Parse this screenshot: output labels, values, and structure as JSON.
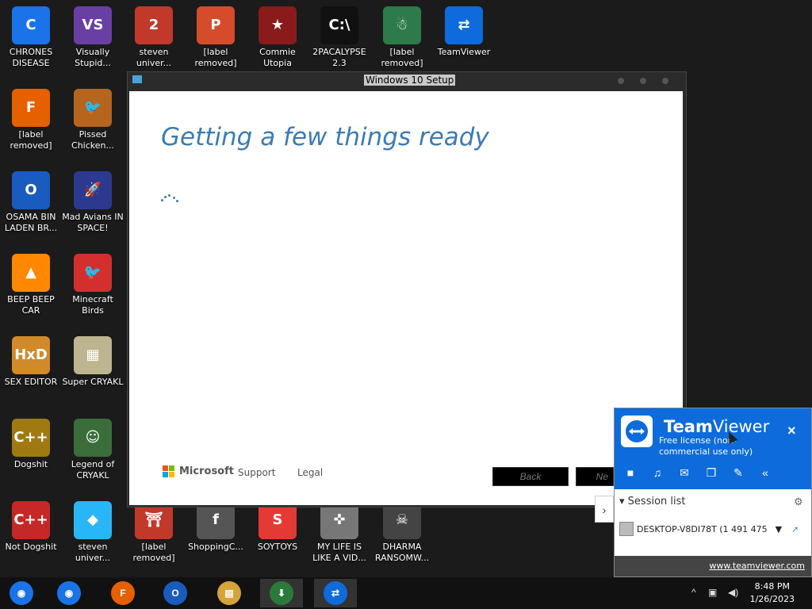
{
  "colors": {
    "desktop_bg": "#1b1b1b",
    "accent_blue": "#3b7bb5",
    "teamviewer_blue": "#0e6bdc"
  },
  "desktop": {
    "icons": [
      {
        "label": "CHRONES DISEASE",
        "icon": "chrome-icon",
        "color": "#1a73e8"
      },
      {
        "label": "Visually Stupid...",
        "icon": "visual-studio-icon",
        "color": "#6a3fa3"
      },
      {
        "label": "steven univer...",
        "icon": "game-2-icon",
        "color": "#c0392b"
      },
      {
        "label": "[label removed]",
        "icon": "p-game-icon",
        "color": "#d64b2b"
      },
      {
        "label": "Commie Utopia",
        "icon": "game-emblem-icon",
        "color": "#8b1a1a"
      },
      {
        "label": "2PACALYPSE 2.3",
        "icon": "command-prompt-icon",
        "color": "#111111"
      },
      {
        "label": "[label removed]",
        "icon": "elf-game-icon",
        "color": "#2d7a4a"
      },
      {
        "label": "TeamViewer",
        "icon": "teamviewer-icon",
        "color": "#0e6bdc"
      },
      {
        "label": "[label removed]",
        "icon": "firefox-icon",
        "color": "#e66000"
      },
      {
        "label": "Pissed Chicken...",
        "icon": "angry-birds-seasons-icon",
        "color": "#b5651d"
      },
      {
        "label": "OSAMA BIN LADEN BR...",
        "icon": "obama-logo-icon",
        "color": "#1a5bbf"
      },
      {
        "label": "Mad Avians IN SPACE!",
        "icon": "angry-birds-space-icon",
        "color": "#2b3a8f"
      },
      {
        "label": "BEEP BEEP CAR",
        "icon": "vlc-cone-icon",
        "color": "#ff8800"
      },
      {
        "label": "Minecraft Birds",
        "icon": "angry-bird-icon",
        "color": "#d32f2f"
      },
      {
        "label": "SEX EDITOR",
        "icon": "hxd-icon",
        "color": "#d08a2a"
      },
      {
        "label": "Super CRYAKL",
        "icon": "pixel-cat-icon",
        "color": "#bdb58f"
      },
      {
        "label": "Dogshit",
        "icon": "dev-cpp-gold-icon",
        "color": "#a07a10"
      },
      {
        "label": "Legend of CRYAKL",
        "icon": "pixel-hero-icon",
        "color": "#3a6d3a"
      },
      {
        "label": "Not Dogshit",
        "icon": "dev-cpp-icon",
        "color": "#c62828"
      },
      {
        "label": "steven univer...",
        "icon": "diamond-icon",
        "color": "#29b6f6"
      },
      {
        "label": "[label removed]",
        "icon": "torii-gate-icon",
        "color": "#c0392b"
      },
      {
        "label": "ShoppingC...",
        "icon": "flash-icon",
        "color": "#555555"
      },
      {
        "label": "SOYTOYS",
        "icon": "s-logo-icon",
        "color": "#e53935"
      },
      {
        "label": "MY LIFE IS LIKE A VID...",
        "icon": "gamepad-icon",
        "color": "#777777"
      },
      {
        "label": "DHARMA RANSOMW...",
        "icon": "skull-icon",
        "color": "#444444"
      }
    ],
    "icon_glyphs": [
      "C",
      "VS",
      "2",
      "P",
      "★",
      "C:\\",
      "☃",
      "⇄",
      "F",
      "🐦",
      "O",
      "🚀",
      "▲",
      "🐦",
      "HxD",
      "▦",
      "C++",
      "☺",
      "C++",
      "◆",
      "⛩",
      "f",
      "S",
      "✜",
      "☠"
    ]
  },
  "setup_window": {
    "title": "Windows 10 Setup",
    "heading": "Getting a few things ready",
    "footer": {
      "brand": "Microsoft",
      "support": "Support",
      "legal": "Legal"
    },
    "buttons": {
      "back": "Back",
      "next": "Ne"
    }
  },
  "teamviewer": {
    "name_bold": "Team",
    "name_light": "Viewer",
    "license": "Free license (non-commercial use only)",
    "close": "×",
    "session_list": "Session list",
    "device": "DESKTOP-V8DI78T (1 491 475",
    "url": "www.teamviewer.com",
    "tools": [
      "video-icon",
      "headset-icon",
      "chat-icon",
      "files-icon",
      "broom-icon",
      "collapse-icon"
    ],
    "tool_glyphs": [
      "■",
      "♫",
      "✉",
      "❐",
      "✎",
      "«"
    ]
  },
  "taskbar": {
    "items": [
      "chrome-icon",
      "chrome-icon",
      "firefox-icon",
      "obama-logo-icon",
      "file-explorer-icon",
      "windows-setup-icon",
      "teamviewer-icon"
    ],
    "glyphs": [
      "◉",
      "◉",
      "F",
      "O",
      "▤",
      "⬇",
      "⇄"
    ],
    "colors": [
      "#1a73e8",
      "#1a73e8",
      "#e66000",
      "#1a5bbf",
      "#d4a43a",
      "#2a7a3a",
      "#0e6bdc"
    ],
    "time": "8:48 PM",
    "date": "1/26/2023"
  }
}
